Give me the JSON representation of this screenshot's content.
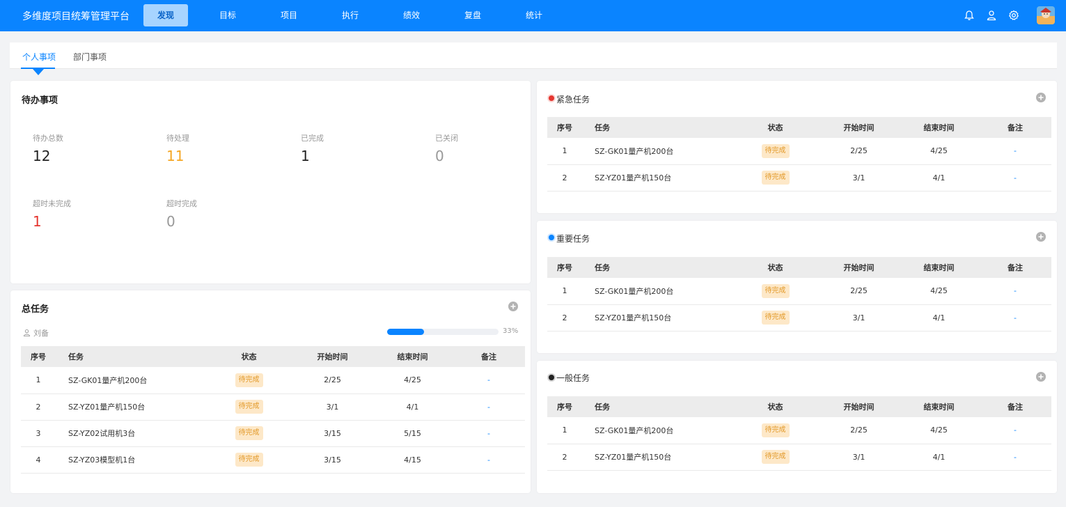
{
  "app": {
    "title": "多维度项目统筹管理平台"
  },
  "nav": {
    "items": [
      {
        "label": "发现",
        "active": true
      },
      {
        "label": "目标"
      },
      {
        "label": "项目"
      },
      {
        "label": "执行"
      },
      {
        "label": "绩效"
      },
      {
        "label": "复盘"
      },
      {
        "label": "统计"
      }
    ],
    "icons": [
      "bell-icon",
      "user-icon",
      "gear-icon"
    ]
  },
  "tabs": [
    {
      "label": "个人事项",
      "active": true
    },
    {
      "label": "部门事项"
    }
  ],
  "todo": {
    "title": "待办事项",
    "stats": [
      {
        "label": "待办总数",
        "value": "12",
        "color": "#222222"
      },
      {
        "label": "待处理",
        "value": "11",
        "color": "#f5a623"
      },
      {
        "label": "已完成",
        "value": "1",
        "color": "#222222"
      },
      {
        "label": "已关闭",
        "value": "0",
        "color": "#999999"
      },
      {
        "label": "超时未完成",
        "value": "1",
        "color": "#e5352f"
      },
      {
        "label": "超时完成",
        "value": "0",
        "color": "#999999"
      }
    ]
  },
  "table_headers": [
    "序号",
    "任务",
    "状态",
    "开始时间",
    "结束时间",
    "备注"
  ],
  "total": {
    "title": "总任务",
    "owner": "刘备",
    "progress": 0.33,
    "progress_text": "33%",
    "rows": [
      {
        "no": "1",
        "task": "SZ-GK01量产机200台",
        "status": "待完成",
        "start": "2/25",
        "end": "4/25",
        "note": "-"
      },
      {
        "no": "2",
        "task": "SZ-YZ01量产机150台",
        "status": "待完成",
        "start": "3/1",
        "end": "4/1",
        "note": "-"
      },
      {
        "no": "3",
        "task": "SZ-YZ02试用机3台",
        "status": "待完成",
        "start": "3/15",
        "end": "5/15",
        "note": "-"
      },
      {
        "no": "4",
        "task": "SZ-YZ03模型机1台",
        "status": "待完成",
        "start": "3/15",
        "end": "4/15",
        "note": "-"
      }
    ]
  },
  "priority_groups": [
    {
      "title": "紧急任务",
      "dot_color": "#e5352f",
      "rows": [
        {
          "no": "1",
          "task": "SZ-GK01量产机200台",
          "status": "待完成",
          "start": "2/25",
          "end": "4/25",
          "note": "-"
        },
        {
          "no": "2",
          "task": "SZ-YZ01量产机150台",
          "status": "待完成",
          "start": "3/1",
          "end": "4/1",
          "note": "-"
        }
      ]
    },
    {
      "title": "重要任务",
      "dot_color": "#0a84ff",
      "rows": [
        {
          "no": "1",
          "task": "SZ-GK01量产机200台",
          "status": "待完成",
          "start": "2/25",
          "end": "4/25",
          "note": "-"
        },
        {
          "no": "2",
          "task": "SZ-YZ01量产机150台",
          "status": "待完成",
          "start": "3/1",
          "end": "4/1",
          "note": "-"
        }
      ]
    },
    {
      "title": "一般任务",
      "dot_color": "#222222",
      "rows": [
        {
          "no": "1",
          "task": "SZ-GK01量产机200台",
          "status": "待完成",
          "start": "2/25",
          "end": "4/25",
          "note": "-"
        },
        {
          "no": "2",
          "task": "SZ-YZ01量产机150台",
          "status": "待完成",
          "start": "3/1",
          "end": "4/1",
          "note": "-"
        }
      ]
    }
  ]
}
